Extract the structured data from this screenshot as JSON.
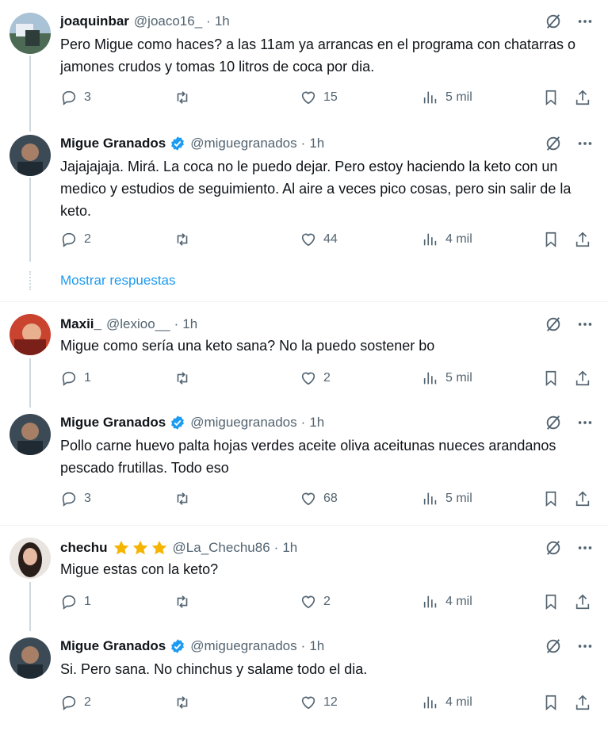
{
  "tweets": [
    {
      "name": "joaquinbar",
      "handle": "@joaco16_",
      "time": "1h",
      "verified": false,
      "stars": 0,
      "text": "Pero Migue como haces? a las 11am ya arrancas en el programa con chatarras o jamones crudos y tomas 10 litros de coca por dia.",
      "replies": "3",
      "likes": "15",
      "views": "5 mil"
    },
    {
      "name": "Migue Granados",
      "handle": "@miguegranados",
      "time": "1h",
      "verified": true,
      "stars": 0,
      "text": "Jajajajaja. Mirá. La coca no le puedo dejar. Pero estoy haciendo la keto con un medico y estudios de seguimiento. Al aire a veces pico cosas, pero sin salir de la keto.",
      "replies": "2",
      "likes": "44",
      "views": "4 mil"
    },
    {
      "name": "Maxii_",
      "handle": "@lexioo__",
      "time": "1h",
      "verified": false,
      "stars": 0,
      "text": "Migue como sería una keto sana? No la puedo sostener bo",
      "replies": "1",
      "likes": "2",
      "views": "5 mil"
    },
    {
      "name": "Migue Granados",
      "handle": "@miguegranados",
      "time": "1h",
      "verified": true,
      "stars": 0,
      "text": "Pollo carne huevo palta hojas verdes aceite oliva aceitunas nueces arandanos pescado frutillas. Todo eso",
      "replies": "3",
      "likes": "68",
      "views": "5 mil"
    },
    {
      "name": "chechu",
      "handle": "@La_Chechu86",
      "time": "1h",
      "verified": false,
      "stars": 3,
      "text": "Migue estas con la keto?",
      "replies": "1",
      "likes": "2",
      "views": "4 mil"
    },
    {
      "name": "Migue Granados",
      "handle": "@miguegranados",
      "time": "1h",
      "verified": true,
      "stars": 0,
      "text": "Si. Pero sana. No chinchus y salame todo el dia.",
      "replies": "2",
      "likes": "12",
      "views": "4 mil"
    }
  ],
  "show_replies_label": "Mostrar respuestas",
  "separator_dot": "·",
  "colors": {
    "link_blue": "#1d9bf0",
    "secondary_text": "#536471",
    "verified_blue": "#1d9bf0",
    "star_gold": "#f5b400"
  },
  "icons": [
    "grok-icon",
    "more-icon",
    "reply-icon",
    "retweet-icon",
    "like-icon",
    "views-icon",
    "bookmark-icon",
    "share-icon",
    "verified-badge-icon",
    "star-icon"
  ]
}
